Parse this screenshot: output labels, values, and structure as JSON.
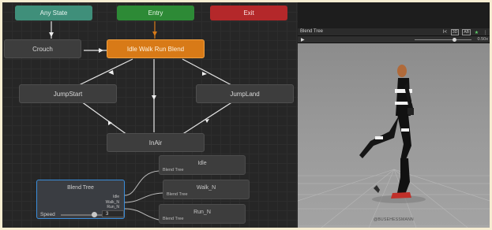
{
  "graph": {
    "nodes": {
      "any_state": "Any State",
      "entry": "Entry",
      "exit": "Exit",
      "crouch": "Crouch",
      "idle_walk_run_blend": "Idle Walk Run Blend",
      "jump_start": "JumpStart",
      "jump_land": "JumpLand",
      "in_air": "InAir"
    },
    "blend_tree": {
      "title": "Blend Tree",
      "ports": [
        "Idle",
        "Walk_N",
        "Run_N"
      ],
      "parameter_label": "Speed",
      "parameter_value": "3",
      "slider_fraction": 0.6
    },
    "clips": [
      {
        "title": "Idle",
        "subtitle": "Blend Tree"
      },
      {
        "title": "Walk_N",
        "subtitle": "Blend Tree"
      },
      {
        "title": "Run_N",
        "subtitle": "Blend Tree"
      }
    ]
  },
  "preview": {
    "title": "Blend Tree",
    "toolbar": {
      "prev_icon": "I<",
      "speed_badge": "3D",
      "camera_badge": "AB",
      "star_icon": "★",
      "menu_icon": "⋮"
    },
    "play_icon": "▶",
    "time_value": "0.50x",
    "watermark": "@BUSEHESSMANN"
  },
  "colors": {
    "any_state": "#3f8f7a",
    "entry": "#2d8a36",
    "exit": "#b4282a",
    "default_state": "#d87a17",
    "blend_outline": "#3a8edc"
  }
}
